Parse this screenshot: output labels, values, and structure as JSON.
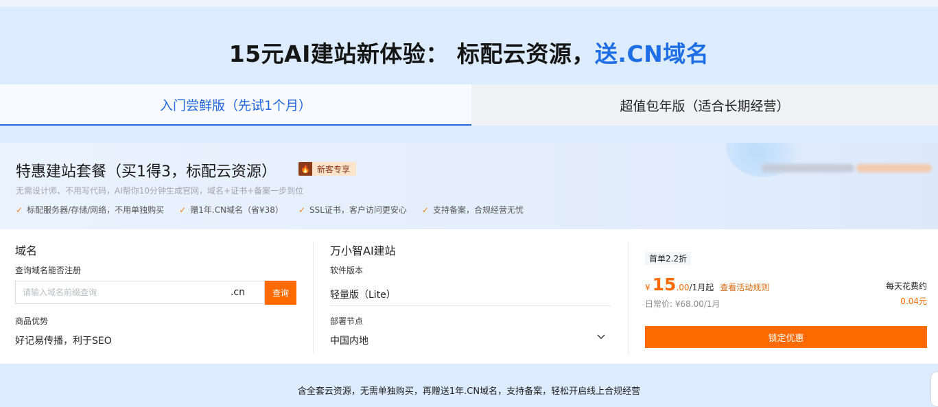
{
  "headline": {
    "main": "15元AI建站新体验： 标配云资源，",
    "highlight": "送.CN域名"
  },
  "tabs": [
    {
      "label": "入门尝鲜版（先试1个月）",
      "active": true
    },
    {
      "label": "超值包年版（适合长期经营）",
      "active": false
    }
  ],
  "promo": {
    "title": "特惠建站套餐（买1得3，标配云资源）",
    "badge": "新客专享",
    "badge_icon": "fire-icon",
    "subtitle": "无需设计师、不用写代码，AI帮你10分钟生成官网，域名+证书+备案一步到位",
    "features": [
      "标配服务器/存储/网络，不用单独购买",
      "赠1年.CN域名（省¥38）",
      "SSL证书，客户访问更安心",
      "支持备案，合规经营无忧"
    ]
  },
  "domain": {
    "title": "域名",
    "query_label": "查询域名能否注册",
    "placeholder": "请输入域名前缀查询",
    "suffix": ".cn",
    "search_label": "查询",
    "advantage_label": "商品优势",
    "advantage_value": "好记易传播，利于SEO"
  },
  "site": {
    "title": "万小智AI建站",
    "version_label": "软件版本",
    "version_value": "轻量版（Lite）",
    "node_label": "部署节点",
    "node_value": "中国内地"
  },
  "pricing": {
    "discount_tag": "首单2.2折",
    "currency": "¥",
    "price_int": "15",
    "price_dec": ".00",
    "unit": "/1月起",
    "rules_link": "查看活动规则",
    "regular_price": "日常价: ¥68.00/1月",
    "daily_label": "每天花费约",
    "daily_value": "0.04元",
    "lock_button": "锁定优惠"
  },
  "footer": "含全套云资源，无需单独购买，再赠送1年.CN域名，支持备案，轻松开启线上合规经营",
  "colors": {
    "accent_blue": "#1e6fe6",
    "accent_orange": "#ff6a00",
    "page_bg": "#dcebfd"
  }
}
